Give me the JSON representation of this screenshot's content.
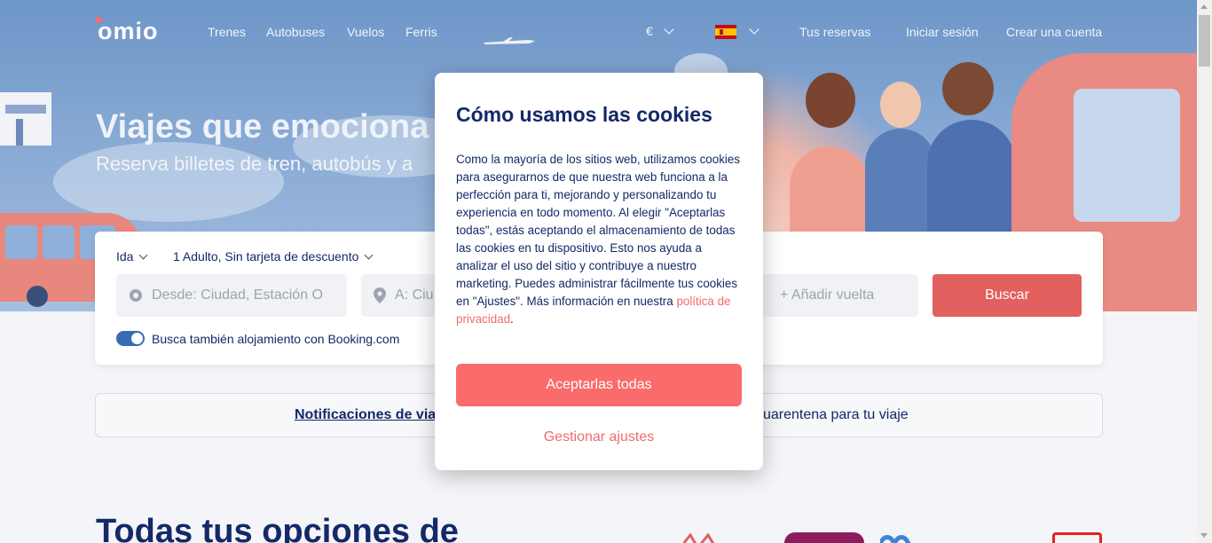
{
  "header": {
    "logo": "omio",
    "nav": [
      "Trenes",
      "Autobuses",
      "Vuelos",
      "Ferris"
    ],
    "currency": "€",
    "language_flag": "spain-flag",
    "bookings": "Tus reservas",
    "login": "Iniciar sesión",
    "signup": "Crear una cuenta"
  },
  "hero": {
    "title": "Viajes que emociona",
    "subtitle": "Reserva billetes de tren, autobús y a"
  },
  "search": {
    "trip_type": "Ida",
    "passengers": "1 Adulto, Sin tarjeta de descuento",
    "from_placeholder": "Desde: Ciudad, Estación O",
    "to_placeholder": "A: Ciu",
    "return_placeholder": "+ Añadir vuelta",
    "submit": "Buscar",
    "booking_toggle_label": "Busca también alojamiento con Booking.com",
    "booking_toggle_on": true
  },
  "notice": {
    "link": "Notificaciones de via",
    "text": "uarentena para tu viaje"
  },
  "section": {
    "title": "Todas tus opciones de"
  },
  "cookie_modal": {
    "title": "Cómo usamos las cookies",
    "body_text": "Como la mayoría de los sitios web, utilizamos cookies para asegurarnos de que nuestra web funciona a la perfección para ti, mejorando y personalizando tu experiencia en todo momento. Al elegir \"Aceptarlas todas\", estás aceptando el almacenamiento de todas las cookies en tu dispositivo. Esto nos ayuda a analizar el uso del sitio y contribuye a nuestro marketing. Puedes administrar fácilmente tus cookies en \"Ajustes\". Más información en nuestra ",
    "privacy_link": "política de privacidad",
    "body_end": ".",
    "accept_button": "Aceptarlas todas",
    "manage_button": "Gestionar ajustes"
  },
  "colors": {
    "brand_navy": "#132968",
    "accent_coral": "#fa6b6b",
    "search_button": "#e2605d"
  }
}
